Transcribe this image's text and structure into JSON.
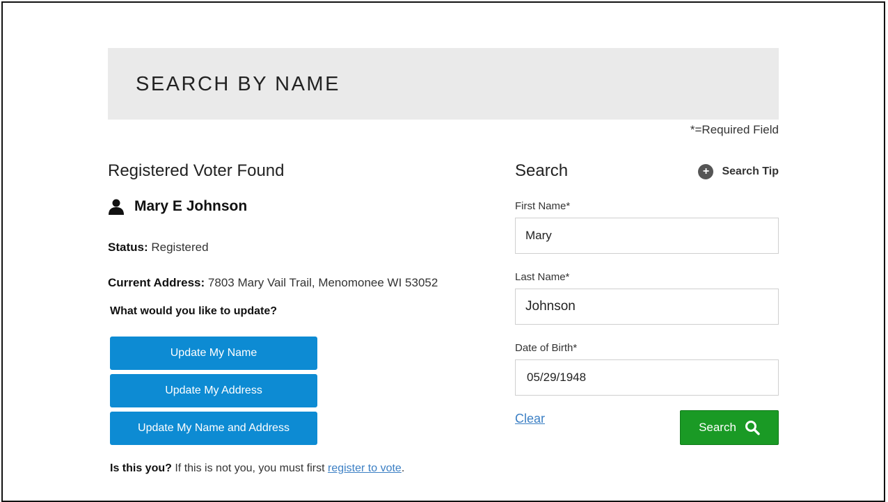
{
  "header": {
    "title": "SEARCH BY NAME"
  },
  "required_note": "*=Required Field",
  "result": {
    "heading": "Registered Voter Found",
    "voter_name": "Mary E Johnson",
    "status_label": "Status",
    "status_value": "Registered",
    "address_label": "Current Address:",
    "address_value": "7803 Mary Vail Trail, Menomonee WI 53052",
    "question": "What would you like to update?",
    "buttons": [
      {
        "label": "Update My Name"
      },
      {
        "label": "Update My Address"
      },
      {
        "label": "Update My Name and Address"
      }
    ],
    "footer_bold": "Is this you?",
    "footer_text": "If this is not you, you must first",
    "footer_link": "register to vote",
    "footer_end": "."
  },
  "search": {
    "heading": "Search",
    "tip_label": "Search Tip",
    "first_name_label": "First Name*",
    "first_name_value": "Mary",
    "last_name_label": "Last Name*",
    "last_name_value": "Johnson",
    "dob_label": "Date of Birth*",
    "dob_value": "05/29/1948",
    "clear_label": "Clear",
    "search_label": "Search"
  },
  "icons": {
    "person": "user-icon",
    "plus": "plus-circle-icon",
    "search": "search-icon"
  },
  "colors": {
    "primary_button": "#0d8bd3",
    "search_button": "#1a9a25",
    "link": "#3b7fc4",
    "header_band": "#eaeaea"
  }
}
